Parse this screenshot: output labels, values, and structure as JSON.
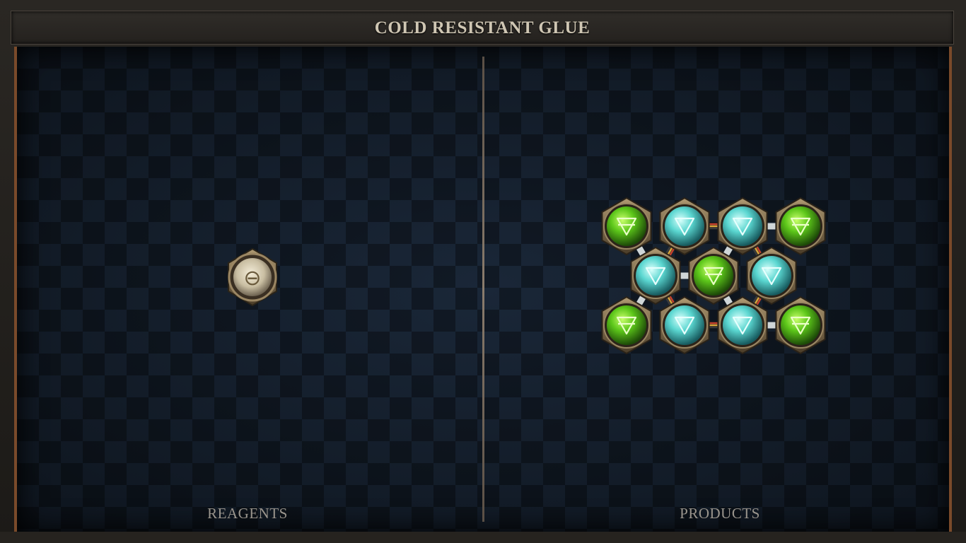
{
  "title": "COLD RESISTANT GLUE",
  "panels": {
    "reagents_label": "REAGENTS",
    "products_label": "PRODUCTS"
  },
  "reagent": {
    "icon": "salt-symbol-icon",
    "glyph": "⊖"
  },
  "colors": {
    "board_bg": "#111a25",
    "frame_accent": "#7a4a2a",
    "green_atom": "#5cc61a",
    "teal_atom": "#5ad6d0",
    "bronze": "#8a7350"
  },
  "product_molecule": {
    "atoms": [
      {
        "id": "a1",
        "element": "earth",
        "icon": "earth-symbol-icon",
        "row": 0,
        "col": 0
      },
      {
        "id": "a2",
        "element": "water",
        "icon": "water-symbol-icon",
        "row": 0,
        "col": 1
      },
      {
        "id": "a3",
        "element": "water",
        "icon": "water-symbol-icon",
        "row": 0,
        "col": 2
      },
      {
        "id": "a4",
        "element": "earth",
        "icon": "earth-symbol-icon",
        "row": 0,
        "col": 3
      },
      {
        "id": "a5",
        "element": "water",
        "icon": "water-symbol-icon",
        "row": 1,
        "col": 0
      },
      {
        "id": "a6",
        "element": "earth",
        "icon": "earth-symbol-icon",
        "row": 1,
        "col": 1
      },
      {
        "id": "a7",
        "element": "water",
        "icon": "water-symbol-icon",
        "row": 1,
        "col": 2
      },
      {
        "id": "a8",
        "element": "earth",
        "icon": "earth-symbol-icon",
        "row": 2,
        "col": 0
      },
      {
        "id": "a9",
        "element": "water",
        "icon": "water-symbol-icon",
        "row": 2,
        "col": 1
      },
      {
        "id": "a10",
        "element": "water",
        "icon": "water-symbol-icon",
        "row": 2,
        "col": 2
      },
      {
        "id": "a11",
        "element": "earth",
        "icon": "earth-symbol-icon",
        "row": 2,
        "col": 3
      }
    ],
    "bonds": [
      {
        "from": "a1",
        "to": "a5",
        "type": "normal"
      },
      {
        "from": "a2",
        "to": "a3",
        "type": "triplex"
      },
      {
        "from": "a3",
        "to": "a4",
        "type": "normal"
      },
      {
        "from": "a2",
        "to": "a5",
        "type": "triplex"
      },
      {
        "from": "a3",
        "to": "a6",
        "type": "normal"
      },
      {
        "from": "a3",
        "to": "a7",
        "type": "triplex"
      },
      {
        "from": "a5",
        "to": "a6",
        "type": "normal"
      },
      {
        "from": "a5",
        "to": "a8",
        "type": "normal"
      },
      {
        "from": "a5",
        "to": "a9",
        "type": "triplex"
      },
      {
        "from": "a6",
        "to": "a10",
        "type": "normal"
      },
      {
        "from": "a7",
        "to": "a10",
        "type": "triplex"
      },
      {
        "from": "a9",
        "to": "a10",
        "type": "triplex"
      },
      {
        "from": "a10",
        "to": "a11",
        "type": "normal"
      }
    ]
  }
}
